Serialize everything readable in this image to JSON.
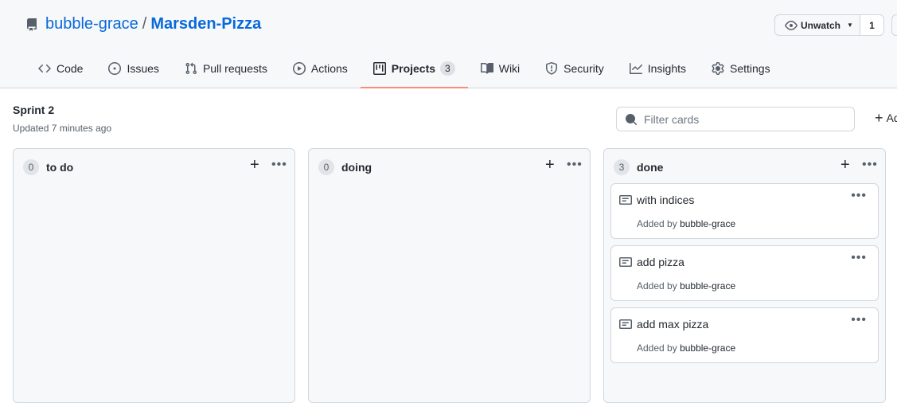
{
  "repo": {
    "owner": "bubble-grace",
    "separator": "/",
    "name": "Marsden-Pizza"
  },
  "watch": {
    "label": "Unwatch",
    "count": "1"
  },
  "tabs": [
    {
      "label": "Code",
      "icon": "code-icon"
    },
    {
      "label": "Issues",
      "icon": "issue-icon"
    },
    {
      "label": "Pull requests",
      "icon": "pull-request-icon"
    },
    {
      "label": "Actions",
      "icon": "play-icon"
    },
    {
      "label": "Projects",
      "icon": "project-icon",
      "counter": "3",
      "selected": true
    },
    {
      "label": "Wiki",
      "icon": "book-icon"
    },
    {
      "label": "Security",
      "icon": "shield-icon"
    },
    {
      "label": "Insights",
      "icon": "graph-icon"
    },
    {
      "label": "Settings",
      "icon": "gear-icon"
    }
  ],
  "project": {
    "title": "Sprint 2",
    "updated": "Updated 7 minutes ago",
    "filter_placeholder": "Filter cards",
    "add_column_label": "Ad"
  },
  "columns": [
    {
      "count": "0",
      "name": "to do",
      "cards": []
    },
    {
      "count": "0",
      "name": "doing",
      "cards": []
    },
    {
      "count": "3",
      "name": "done",
      "cards": [
        {
          "title": "with indices",
          "meta_prefix": "Added by",
          "author": "bubble-grace"
        },
        {
          "title": "add pizza",
          "meta_prefix": "Added by",
          "author": "bubble-grace"
        },
        {
          "title": "add max pizza",
          "meta_prefix": "Added by",
          "author": "bubble-grace"
        }
      ]
    }
  ],
  "colors": {
    "link": "#0969da",
    "tab_underline": "#fd8c73",
    "column_bg": "#f6f8fa",
    "border": "#d0d7de"
  }
}
